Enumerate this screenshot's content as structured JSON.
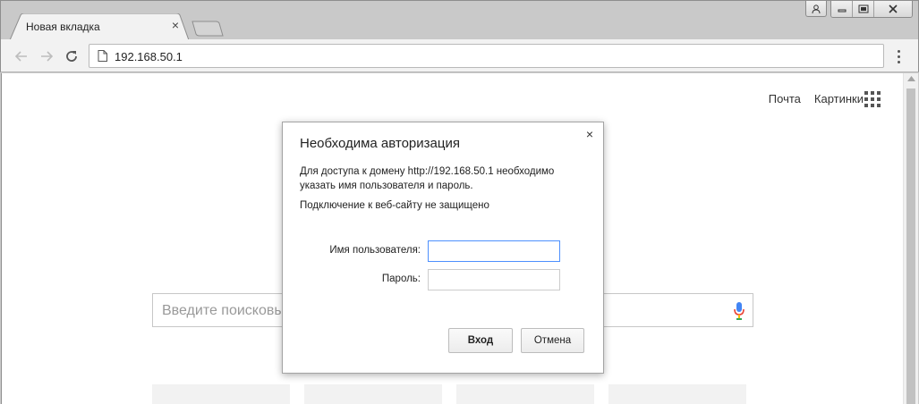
{
  "window": {
    "tab_title": "Новая вкладка",
    "tab_close": "×"
  },
  "toolbar": {
    "url": "192.168.50.1"
  },
  "page": {
    "link_mail": "Почта",
    "link_images": "Картинки",
    "search_placeholder": "Введите поисковы"
  },
  "dialog": {
    "title": "Необходима авторизация",
    "text": "Для доступа к домену http://192.168.50.1 необходимо указать имя пользователя и пароль.",
    "warning": "Подключение к веб-сайту не защищено",
    "username_label": "Имя пользователя:",
    "password_label": "Пароль:",
    "username_value": "",
    "password_value": "",
    "ok_label": "Вход",
    "cancel_label": "Отмена",
    "close_glyph": "×"
  },
  "colors": {
    "focus": "#4d90fe",
    "mic_blue": "#4285f4",
    "mic_red": "#ea4335"
  },
  "icons": [
    "back-arrow-icon",
    "forward-arrow-icon",
    "reload-icon",
    "page-icon",
    "menu-dots-icon",
    "apps-grid-icon",
    "microphone-icon",
    "user-icon",
    "minimize-icon",
    "maximize-icon",
    "close-icon"
  ]
}
